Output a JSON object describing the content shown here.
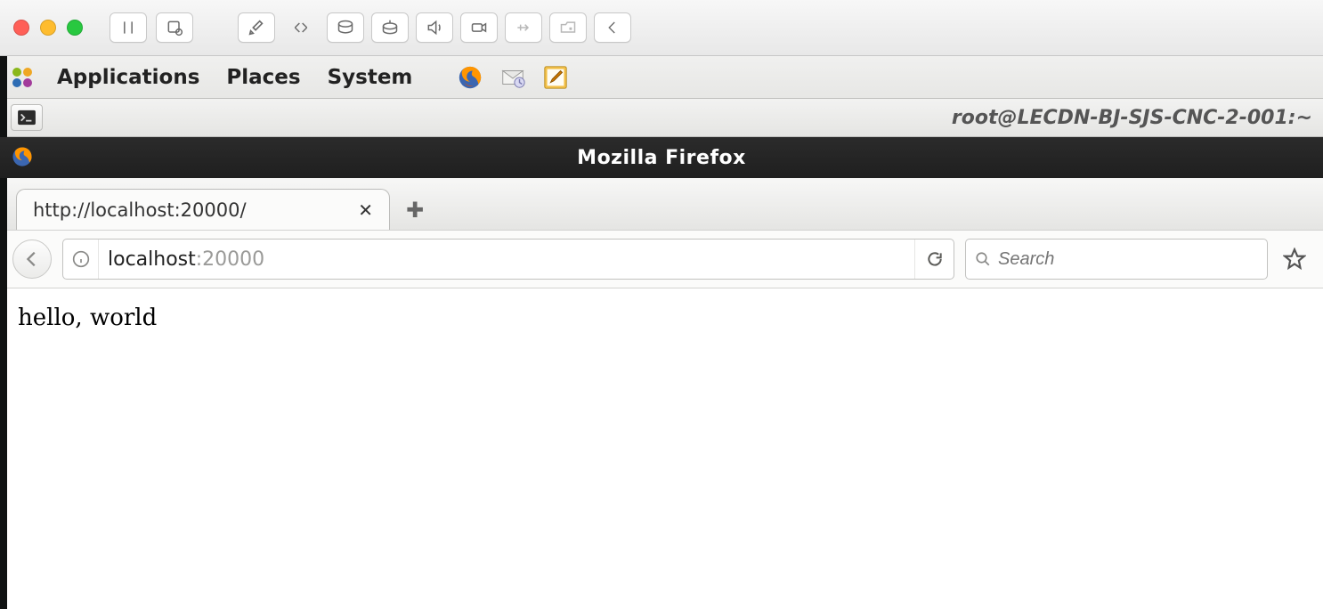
{
  "gnome": {
    "menus": [
      "Applications",
      "Places",
      "System"
    ]
  },
  "taskbar": {
    "title": "root@LECDN-BJ-SJS-CNC-2-001:~"
  },
  "firefox": {
    "title": "Mozilla Firefox",
    "tab": {
      "label": "http://localhost:20000/",
      "close": "✕"
    },
    "newtab": "✚",
    "address": {
      "host": "localhost",
      "port": ":20000"
    },
    "search_placeholder": "Search",
    "page_body": "hello, world"
  }
}
